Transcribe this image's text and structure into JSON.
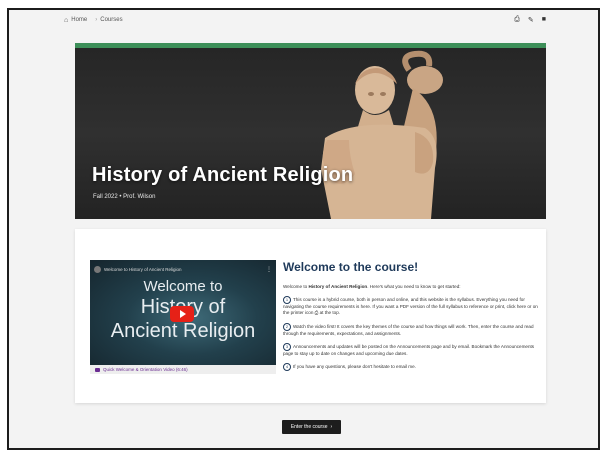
{
  "breadcrumb": {
    "home_icon": "home-icon",
    "home": "Home",
    "separator": "›",
    "courses": "Courses"
  },
  "toolbar_icons": [
    "print-icon",
    "edit-icon",
    "menu-icon"
  ],
  "toolbar_glyphs": {
    "print": "⎙",
    "edit": "✎",
    "menu": "■"
  },
  "hero": {
    "accent_color": "#3d8f59",
    "title": "History of Ancient Religion",
    "subtitle": "Fall 2022 • Prof. Wilson"
  },
  "video": {
    "channel_title": "Welcome to History of Ancient Religion",
    "overlay_line1": "Welcome to",
    "overlay_line2": "History of",
    "overlay_line3": "Ancient Religion",
    "caption": "Quick Welcome & Orientation Video (6:46)",
    "play_icon": "youtube-play-icon"
  },
  "welcome": {
    "heading": "Welcome to the course!",
    "intro_pre": "Welcome to ",
    "intro_bold": "History of Ancient Religion",
    "intro_post": ". Here's what you need to know to get started:",
    "items": [
      {
        "num": "1",
        "text": "This course is a hybrid course, both in person and online, and this website is the syllabus. Everything you need for navigating the course requirements is here. If you want a PDF version of the full syllabus to reference or print, click here or on the printer icon ⎙ at the top."
      },
      {
        "num": "2",
        "text": "Watch the video first! It covers the key themes of the course and how things will work. Then, enter the course and read through the requirements, expectations, and assignments."
      },
      {
        "num": "3",
        "text": "Announcements and updates will be posted on the Announcements page and by email. Bookmark the Announcements page to stay up to date on changes and upcoming due dates."
      },
      {
        "num": "4",
        "text": "If you have any questions, please don't hesitate to email me."
      }
    ]
  },
  "enter_button": {
    "label": "Enter the course",
    "arrow": "›"
  }
}
